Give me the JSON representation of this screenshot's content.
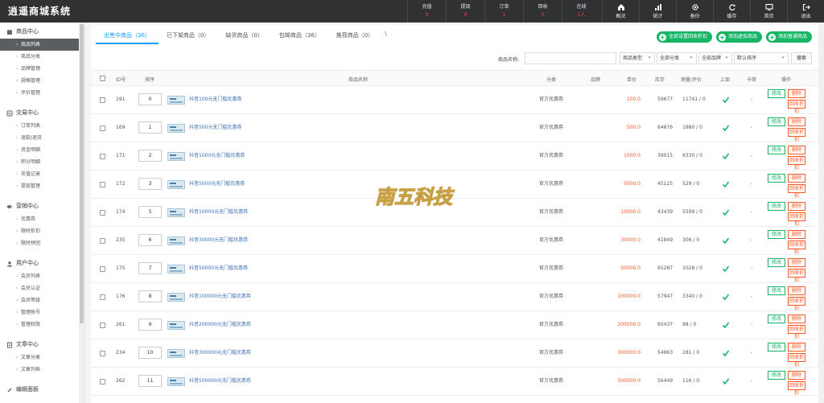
{
  "app": {
    "title": "逍遥商城系统"
  },
  "header_stats": [
    {
      "label": "充值",
      "value": "0"
    },
    {
      "label": "提现",
      "value": "0"
    },
    {
      "label": "订单",
      "value": "1"
    },
    {
      "label": "回收",
      "value": "0"
    },
    {
      "label": "在线",
      "value": "1人"
    }
  ],
  "header_nav": [
    {
      "label": "概况",
      "icon": "home-icon"
    },
    {
      "label": "统计",
      "icon": "bar-chart-icon"
    },
    {
      "label": "备份",
      "icon": "gear-icon"
    },
    {
      "label": "缓存",
      "icon": "refresh-icon"
    },
    {
      "label": "首页",
      "icon": "monitor-icon"
    },
    {
      "label": "退出",
      "icon": "logout-icon"
    }
  ],
  "sidebar": [
    {
      "title": "商品中心",
      "icon": "store-icon",
      "items": [
        "商品列表",
        "商品分类",
        "品牌管理",
        "规格管理",
        "评价管理"
      ]
    },
    {
      "title": "交易中心",
      "icon": "exchange-icon",
      "items": [
        "订单列表",
        "退款/退货",
        "资金明细",
        "积分明细",
        "充值记录",
        "提现管理"
      ]
    },
    {
      "title": "营销中心",
      "icon": "marketing-icon",
      "items": [
        "优惠券",
        "限时折扣",
        "限时拼团"
      ]
    },
    {
      "title": "用户中心",
      "icon": "user-icon",
      "items": [
        "会员列表",
        "会员认证",
        "会员等级",
        "管理账号",
        "管理权限"
      ]
    },
    {
      "title": "文章中心",
      "icon": "document-icon",
      "items": [
        "文章分类",
        "文章列表"
      ]
    },
    {
      "title": "编辑面板",
      "icon": "edit-icon",
      "items": []
    }
  ],
  "tabs": [
    {
      "label": "出售中商品（36）"
    },
    {
      "label": "已下架商品（0）"
    },
    {
      "label": "缺货商品（0）"
    },
    {
      "label": "包邮商品（36）"
    },
    {
      "label": "推荐商品（0）"
    }
  ],
  "tab_caret": "\\",
  "actions": [
    {
      "label": "全部设置回收折扣"
    },
    {
      "label": "添加虚拟商品"
    },
    {
      "label": "添加普通商品"
    }
  ],
  "search": {
    "label": "商品名称:",
    "input_value": "",
    "selects": [
      "商品类型",
      "全部分类",
      "全部品牌",
      "默认排序"
    ],
    "button": "搜索"
  },
  "table": {
    "headers": [
      "ID号",
      "排序",
      "商品名称",
      "分类",
      "品牌",
      "单价",
      "库存",
      "销量/评价",
      "上架",
      "卡密",
      "操作"
    ],
    "op_labels": {
      "edit": "修改",
      "delete": "删除",
      "discount": "回收折扣"
    },
    "rows": [
      {
        "id": "191",
        "sort": "0",
        "name": "抖音100元无门槛优惠券",
        "category": "官方优惠券",
        "brand": "",
        "price": "100.0",
        "stock": "59677",
        "sales": "11741 / 0",
        "card": "-"
      },
      {
        "id": "169",
        "sort": "1",
        "name": "抖音500元无门槛优惠券",
        "category": "官方优惠券",
        "brand": "",
        "price": "500.0",
        "stock": "64876",
        "sales": "1880 / 0",
        "card": "-"
      },
      {
        "id": "171",
        "sort": "2",
        "name": "抖音1000元无门槛优惠券",
        "category": "官方优惠券",
        "brand": "",
        "price": "1000.0",
        "stock": "39015",
        "sales": "6330 / 0",
        "card": "-"
      },
      {
        "id": "172",
        "sort": "3",
        "name": "抖音5000元无门槛优惠券",
        "category": "官方优惠券",
        "brand": "",
        "price": "5000.0",
        "stock": "45125",
        "sales": "529 / 0",
        "card": "-"
      },
      {
        "id": "174",
        "sort": "5",
        "name": "抖音10000元无门槛优惠券",
        "category": "官方优惠券",
        "brand": "",
        "price": "10000.0",
        "stock": "43439",
        "sales": "5599 / 0",
        "card": "-"
      },
      {
        "id": "235",
        "sort": "6",
        "name": "抖音30000元无门槛优惠券",
        "category": "官方优惠券",
        "brand": "",
        "price": "30000.0",
        "stock": "41849",
        "sales": "306 / 0",
        "card": "-"
      },
      {
        "id": "175",
        "sort": "7",
        "name": "抖音50000元无门槛优惠券",
        "category": "官方优惠券",
        "brand": "",
        "price": "50000.0",
        "stock": "65287",
        "sales": "1028 / 0",
        "card": "-"
      },
      {
        "id": "176",
        "sort": "8",
        "name": "抖音100000元无门槛优惠券",
        "category": "官方优惠券",
        "brand": "",
        "price": "100000.0",
        "stock": "57947",
        "sales": "3340 / 0",
        "card": "-"
      },
      {
        "id": "261",
        "sort": "9",
        "name": "抖音200000元无门槛优惠券",
        "category": "官方优惠券",
        "brand": "",
        "price": "200000.0",
        "stock": "65437",
        "sales": "98 / 0",
        "card": "-"
      },
      {
        "id": "234",
        "sort": "10",
        "name": "抖音300000元无门槛优惠券",
        "category": "官方优惠券",
        "brand": "",
        "price": "300000.0",
        "stock": "54963",
        "sales": "281 / 0",
        "card": "-"
      },
      {
        "id": "262",
        "sort": "11",
        "name": "抖音500000元无门槛优惠券",
        "category": "官方优惠券",
        "brand": "",
        "price": "500000.0",
        "stock": "56449",
        "sales": "116 / 0",
        "card": "-"
      }
    ]
  },
  "watermark": {
    "text": "南五科技"
  },
  "colors": {
    "accent": "#1e9fff",
    "green": "#18b566",
    "price": "#ff5722",
    "topbar": "#2f3133",
    "sidebar_active": "#5b5e61"
  }
}
